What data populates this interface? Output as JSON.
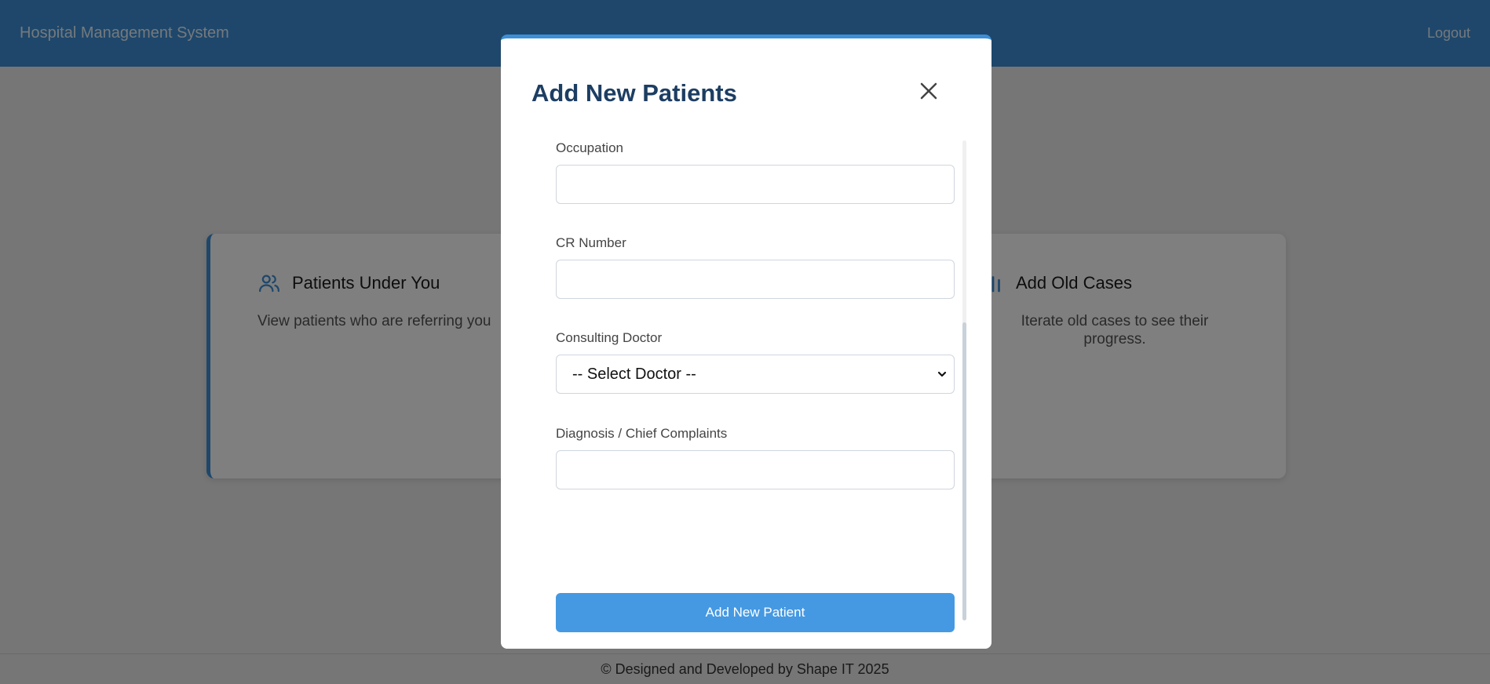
{
  "header": {
    "brand": "Hospital Management System",
    "logout": "Logout"
  },
  "cards": [
    {
      "title": "Patients Under You",
      "description": "View patients who are referring you",
      "icon": "users-icon"
    },
    {
      "title": "Add Old Cases",
      "description": "Iterate old cases to see their progress.",
      "icon": "bar-chart-icon"
    }
  ],
  "footer": {
    "text": "© Designed and Developed by Shape IT 2025"
  },
  "modal": {
    "title": "Add New Patients",
    "fields": [
      {
        "label": "Occupation",
        "value": ""
      },
      {
        "label": "CR Number",
        "value": ""
      },
      {
        "label": "Consulting Doctor",
        "value": "-- Select Doctor --"
      },
      {
        "label": "Diagnosis / Chief Complaints",
        "value": ""
      }
    ],
    "submit_label": "Add New Patient"
  },
  "colors": {
    "primary": "#3c8fd6",
    "title": "#1d3e63",
    "button": "#4599e2"
  }
}
